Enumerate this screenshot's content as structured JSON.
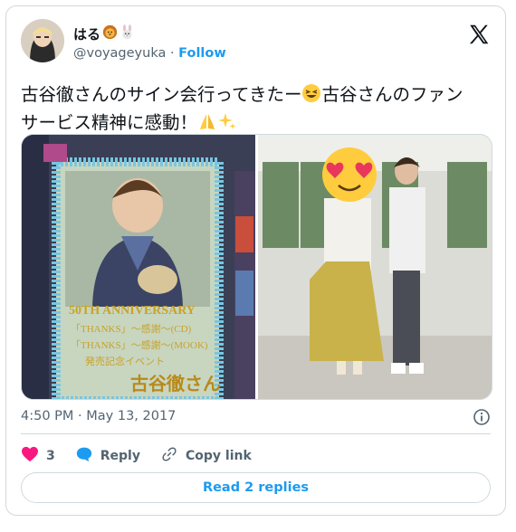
{
  "author": {
    "display_name": "はる",
    "name_emojis": [
      "lion-face",
      "rabbit-face"
    ],
    "handle": "@voyageyuka",
    "separator": "·",
    "follow_label": "Follow"
  },
  "tweet": {
    "line1_a": "古谷徹さんのサイン会行ってきたー",
    "line1_b": "古谷さんのファン",
    "line2": "サービス精神に感動！",
    "emojis": [
      "grinning-squinting-face",
      "folded-hands",
      "sparkles"
    ]
  },
  "media": {
    "left_photo": {
      "poster_lines": [
        "50TH ANNIVERSARY",
        "「THANKS」〜感謝〜(CD)",
        "「THANKS」〜感謝〜(MOOK)",
        "発売記念イベント",
        "古谷徹さん"
      ]
    },
    "right_photo": {
      "sticker_emoji": "smiling-face-with-heart-eyes"
    }
  },
  "meta": {
    "timestamp": "4:50 PM · May 13, 2017"
  },
  "actions": {
    "like_count": "3",
    "reply_label": "Reply",
    "copy_link_label": "Copy link",
    "read_replies_label": "Read 2 replies"
  },
  "colors": {
    "accent": "#1d9bf0",
    "like": "#f91880",
    "text": "#0f1419",
    "muted": "#536471",
    "border": "#cfd9de"
  }
}
